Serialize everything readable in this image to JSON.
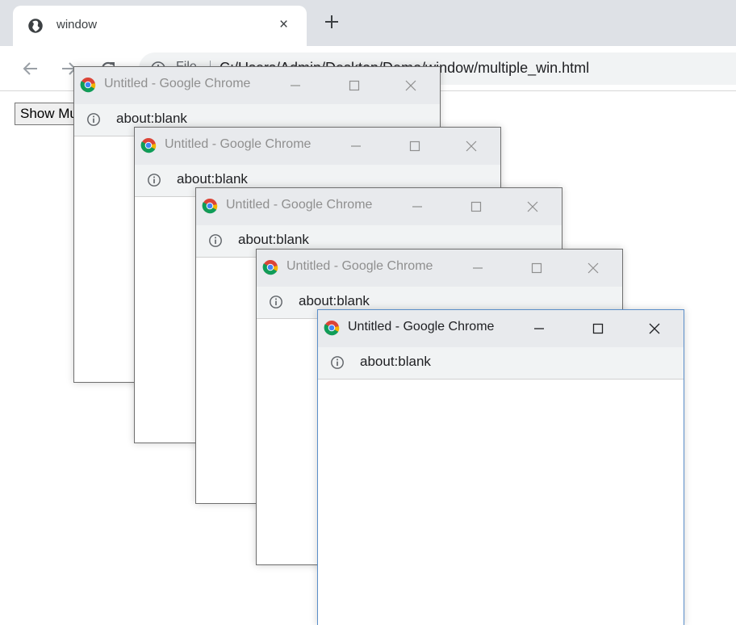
{
  "browser": {
    "tab": {
      "title": "window",
      "close_glyph": "×",
      "icon": "globe-icon"
    },
    "new_tab_icon": "plus-icon",
    "nav_icons": [
      "back-arrow-icon",
      "forward-arrow-icon",
      "reload-icon"
    ],
    "address": {
      "info_icon": "info-icon",
      "scheme_label": "File",
      "url": "C:/Users/Admin/Desktop/Demo/window/multiple_win.html"
    }
  },
  "page": {
    "button_label": "Show Multiple Windows"
  },
  "popups": [
    {
      "title": "Untitled - Google Chrome",
      "url": "about:blank",
      "active": false
    },
    {
      "title": "Untitled - Google Chrome",
      "url": "about:blank",
      "active": false
    },
    {
      "title": "Untitled - Google Chrome",
      "url": "about:blank",
      "active": false
    },
    {
      "title": "Untitled - Google Chrome",
      "url": "about:blank",
      "active": false
    },
    {
      "title": "Untitled - Google Chrome",
      "url": "about:blank",
      "active": true
    }
  ],
  "colors": {
    "tabstrip": "#dee1e6",
    "omnibox": "#f1f3f4",
    "popup_titlebar": "#e8eaed",
    "active_window_border": "#5a8ec9",
    "inactive_title_text": "#8f8f8f",
    "active_title_text": "#202124"
  }
}
